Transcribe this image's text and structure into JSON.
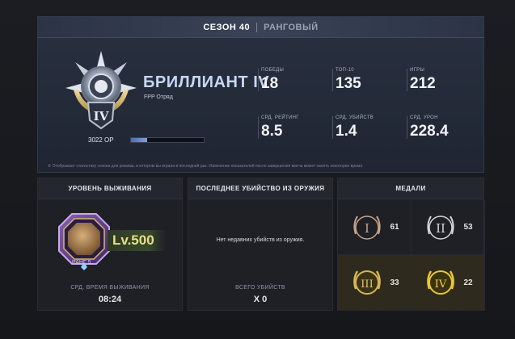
{
  "season_bar": {
    "season": "СЕЗОН 40",
    "mode": "РАНГОВЫЙ"
  },
  "rank": {
    "name": "БРИЛЛИАНТ IV",
    "subtitle": "FPP Отряд",
    "tier_numeral": "IV",
    "rp_label": "3022 ОР",
    "rp_progress": 0.22,
    "emblem_icon": "diamond-rank-emblem"
  },
  "stats": [
    {
      "label": "ПОБЕДЫ",
      "value": "18"
    },
    {
      "label": "ТОП-10",
      "value": "135"
    },
    {
      "label": "ИГРЫ",
      "value": "212"
    },
    {
      "label": "СРД. РЕЙТИНГ",
      "value": "8.5"
    },
    {
      "label": "СРД. УБИЙСТВ",
      "value": "1.4"
    },
    {
      "label": "СРД. УРОН",
      "value": "228.4"
    }
  ],
  "footnote": "※ Отображает статистику сезона для режима, в котором вы играли в последний раз. Изменение показателей после завершения матча может занять некоторое время.",
  "survival": {
    "header": "УРОВЕНЬ ВЫЖИВАНИЯ",
    "level": "Lv.500",
    "rank_label": "РАНГ 5",
    "avg_label": "СРД. ВРЕМЯ ВЫЖИВАНИЯ",
    "avg_value": "08:24"
  },
  "last_kill": {
    "header": "ПОСЛЕДНЕЕ УБИЙСТВО ИЗ ОРУЖИЯ",
    "empty_text": "Нет недавних убийств из оружия.",
    "total_label": "ВСЕГО УБИЙСТВ",
    "total_value": "X 0"
  },
  "medals": {
    "header": "МЕДАЛИ",
    "items": [
      {
        "numeral": "I",
        "count": "61",
        "color": "#c9a58a"
      },
      {
        "numeral": "II",
        "count": "53",
        "color": "#d6d6d6"
      },
      {
        "numeral": "III",
        "count": "33",
        "color": "#d7b455"
      },
      {
        "numeral": "IV",
        "count": "22",
        "color": "#e8c53a"
      }
    ]
  },
  "colors": {
    "accent_rank": "#c7d6f4",
    "level_gold": "#e7df86",
    "panel_bg": "#1e2026"
  }
}
